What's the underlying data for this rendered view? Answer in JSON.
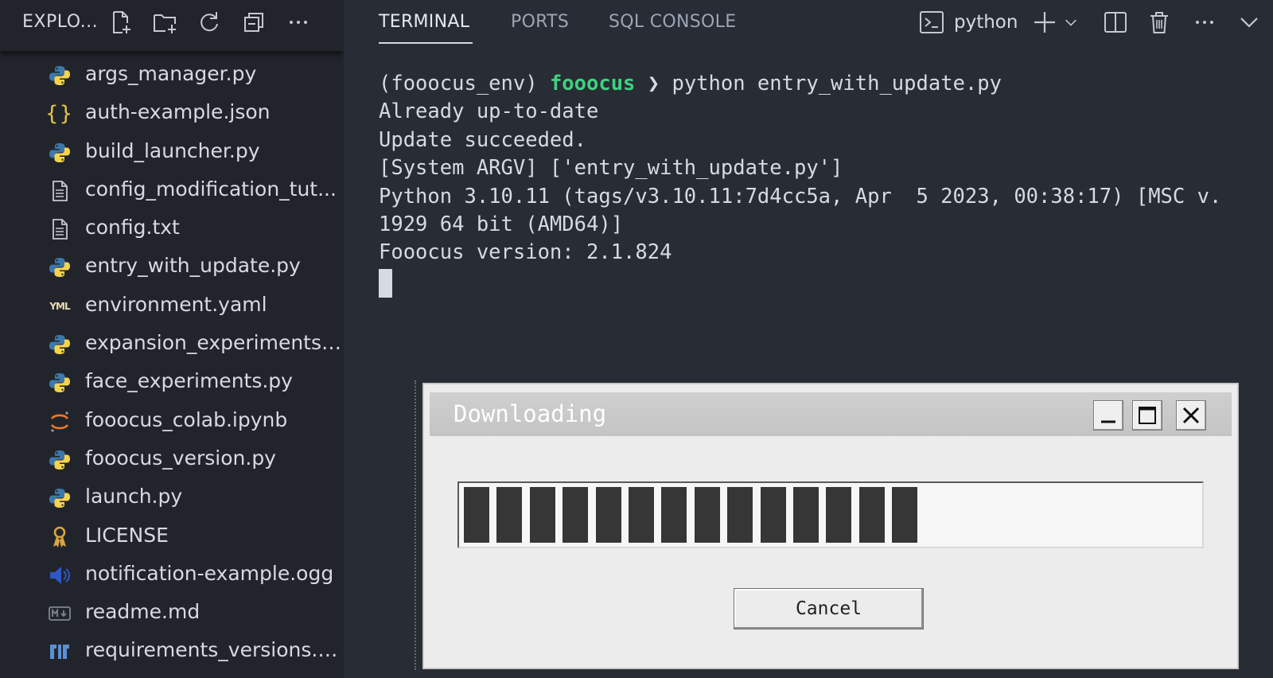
{
  "explorer": {
    "title": "EXPLO...",
    "header_icons": [
      "new-file-icon",
      "new-folder-icon",
      "refresh-icon",
      "collapse-all-icon",
      "more-icon"
    ],
    "files": [
      {
        "name": "args_manager.py",
        "icon": "python-icon"
      },
      {
        "name": "auth-example.json",
        "icon": "json-icon"
      },
      {
        "name": "build_launcher.py",
        "icon": "python-icon"
      },
      {
        "name": "config_modification_tut...",
        "icon": "text-file-icon"
      },
      {
        "name": "config.txt",
        "icon": "text-file-icon"
      },
      {
        "name": "entry_with_update.py",
        "icon": "python-icon"
      },
      {
        "name": "environment.yaml",
        "icon": "yaml-icon"
      },
      {
        "name": "expansion_experiments....",
        "icon": "python-icon"
      },
      {
        "name": "face_experiments.py",
        "icon": "python-icon"
      },
      {
        "name": "fooocus_colab.ipynb",
        "icon": "jupyter-icon"
      },
      {
        "name": "fooocus_version.py",
        "icon": "python-icon"
      },
      {
        "name": "launch.py",
        "icon": "python-icon"
      },
      {
        "name": "LICENSE",
        "icon": "license-icon"
      },
      {
        "name": "notification-example.ogg",
        "icon": "audio-icon"
      },
      {
        "name": "readme.md",
        "icon": "markdown-icon"
      },
      {
        "name": "requirements_versions.txt",
        "icon": "requirements-icon"
      }
    ]
  },
  "panel": {
    "tabs": [
      {
        "label": "TERMINAL",
        "active": true
      },
      {
        "label": "PORTS",
        "active": false
      },
      {
        "label": "SQL CONSOLE",
        "active": false
      }
    ],
    "profile": "python",
    "toolbar_icons": [
      "terminal-profile-icon",
      "add-terminal-icon",
      "chevron-down-icon",
      "split-terminal-icon",
      "trash-icon",
      "more-icon",
      "chevron-down-icon"
    ]
  },
  "terminal": {
    "prompt_env": "(fooocus_env) ",
    "prompt_dir": "fooocus",
    "prompt_arrow": " ❯ ",
    "command": "python entry_with_update.py",
    "lines": [
      "Already up-to-date",
      "Update succeeded.",
      "[System ARGV] ['entry_with_update.py']",
      "Python 3.10.11 (tags/v3.10.11:7d4cc5a, Apr  5 2023, 00:38:17) [MSC v.",
      "1929 64 bit (AMD64)]",
      "Fooocus version: 2.1.824"
    ]
  },
  "dialog": {
    "title": "Downloading",
    "progress": 0.6,
    "progress_blocks": 14,
    "cancel_label": "Cancel",
    "window_buttons": [
      "minimize-icon",
      "maximize-icon",
      "close-icon"
    ]
  },
  "colors": {
    "sidebar_bg": "#21252b",
    "panel_bg": "#282c34",
    "prompt_dir": "#3fd17f",
    "python_blue": "#3c78aa",
    "python_yellow": "#f7d34d",
    "json_yellow": "#e8c547"
  }
}
